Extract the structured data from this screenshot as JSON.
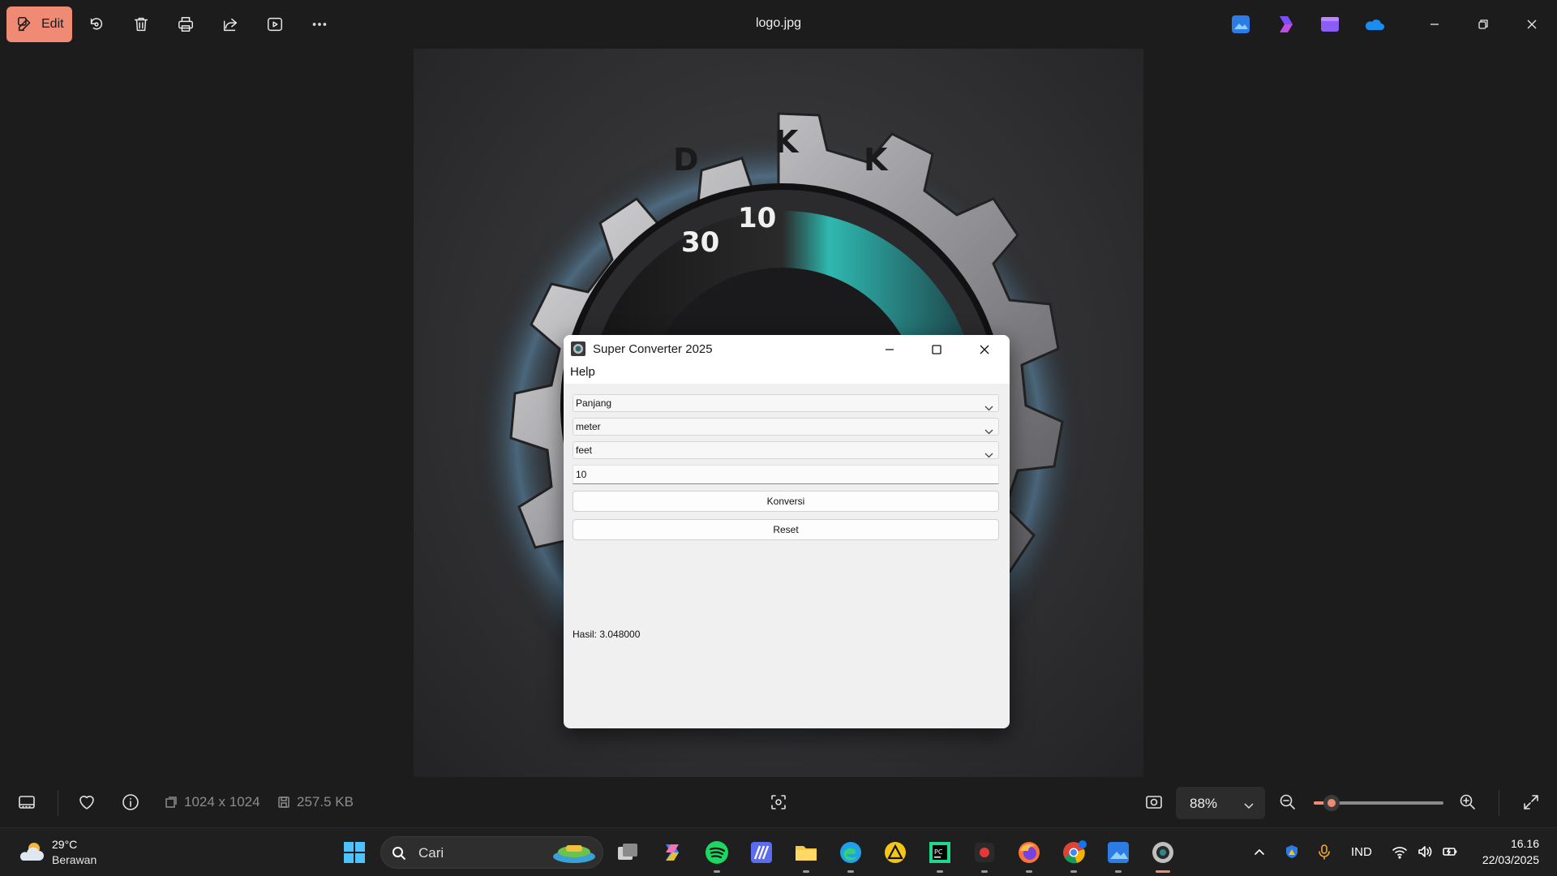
{
  "titlebar": {
    "edit_label": "Edit",
    "file_name": "logo.jpg",
    "toolbar_icons": [
      "rotate-icon",
      "delete-icon",
      "print-icon",
      "share-icon",
      "slideshow-icon",
      "more-icon"
    ],
    "app_icons": [
      "photos-app-icon",
      "clipchamp-icon",
      "video-editor-icon",
      "onedrive-icon"
    ]
  },
  "image": {
    "description_colors": {
      "accent": "#ef8a75",
      "background": "#1c1c1c"
    }
  },
  "dialog": {
    "title": "Super Converter 2025",
    "menu_help": "Help",
    "category": "Panjang",
    "from_unit": "meter",
    "to_unit": "feet",
    "input_value": "10",
    "convert_label": "Konversi",
    "reset_label": "Reset",
    "result_text": "Hasil: 3.048000"
  },
  "bottombar": {
    "dimensions": "1024 x 1024",
    "file_size": "257.5 KB",
    "zoom": "88%",
    "zoom_slider_fraction": 0.14
  },
  "taskbar": {
    "weather_temp": "29°C",
    "weather_desc": "Berawan",
    "search_placeholder": "Cari",
    "language": "IND",
    "time": "16.16",
    "date": "22/03/2025"
  }
}
